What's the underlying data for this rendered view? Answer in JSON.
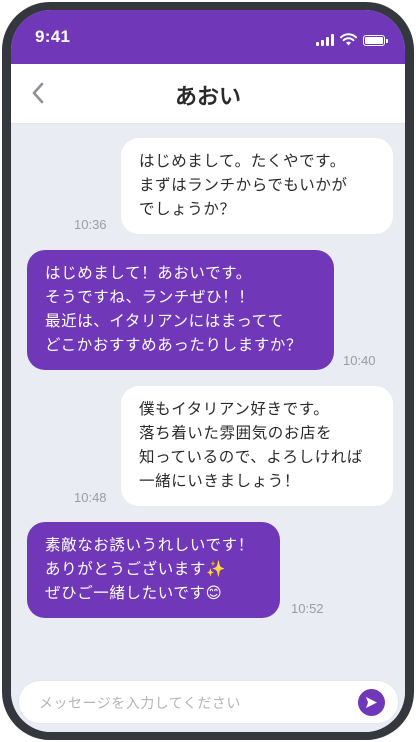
{
  "status_bar": {
    "time": "9:41"
  },
  "header": {
    "title": "あおい"
  },
  "messages": [
    {
      "direction": "received",
      "lines": [
        "はじめまして。たくやです。",
        "まずはランチからでもいかが",
        "でしょうか？"
      ],
      "time": "10:36"
    },
    {
      "direction": "sent",
      "lines": [
        "はじめまして！あおいです。",
        "そうですね、ランチぜひ！！",
        "最近は、イタリアンにはまってて",
        "どこかおすすめあったりしますか？"
      ],
      "time": "10:40"
    },
    {
      "direction": "received",
      "lines": [
        "僕もイタリアン好きです。",
        "落ち着いた雰囲気のお店を",
        "知っているので、よろしければ",
        "一緒にいきましょう！"
      ],
      "time": "10:48"
    },
    {
      "direction": "sent",
      "lines": [
        "素敵なお誘いうれしいです！",
        "ありがとうございます✨",
        "ぜひご一緒したいです😊"
      ],
      "time": "10:52"
    }
  ],
  "input": {
    "placeholder": "メッセージを入力してください"
  },
  "colors": {
    "accent": "#7038b9",
    "background": "#e9ecf2",
    "frame": "#34373d"
  },
  "icons": {
    "back": "chevron-left-icon",
    "send": "send-arrow-icon",
    "signal": "signal-bars-icon",
    "wifi": "wifi-icon",
    "battery": "battery-icon"
  }
}
